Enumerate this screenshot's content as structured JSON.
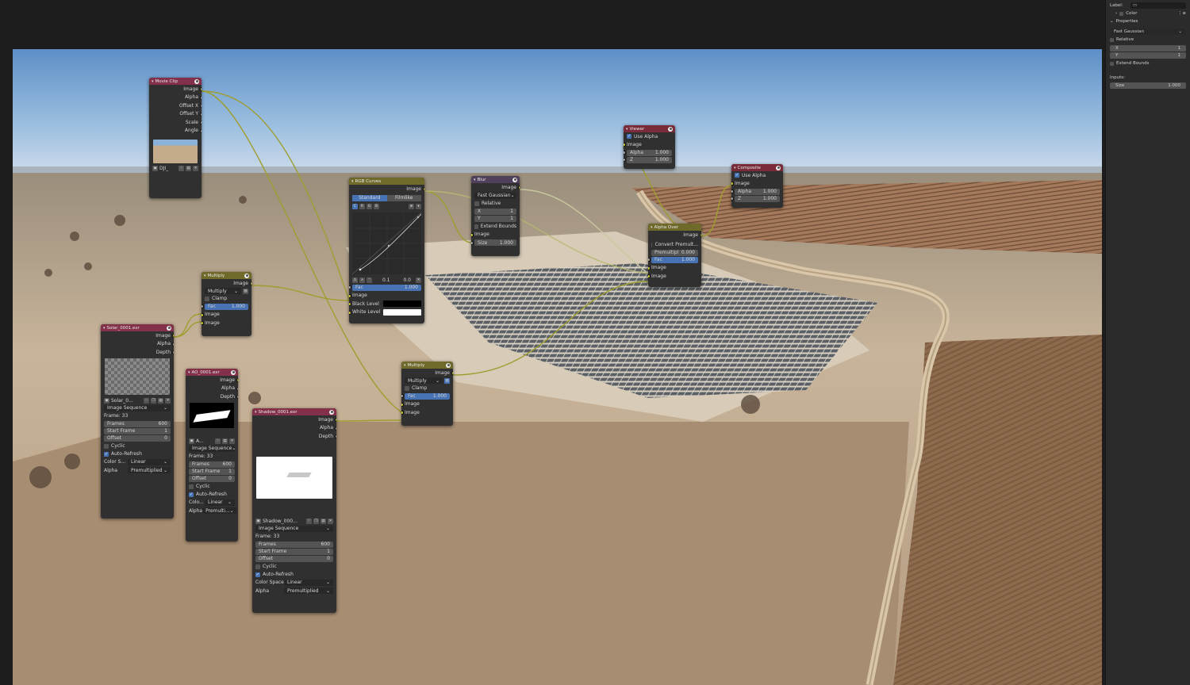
{
  "sidebar": {
    "label_caption": "Label:",
    "color_caption": "Color",
    "properties_caption": "Properties",
    "filter_type": "Fast Gaussian",
    "relative_label": "Relative",
    "x_label": "X",
    "x_value": "1",
    "y_label": "Y",
    "y_value": "1",
    "extend_bounds_label": "Extend Bounds",
    "inputs_caption": "Inputs:",
    "size_label": "Size",
    "size_value": "1.000"
  },
  "nodes": {
    "movie_clip": {
      "title": "Movie Clip",
      "outputs": [
        "Image",
        "Alpha",
        "Offset X",
        "Offset Y",
        "Scale",
        "Angle"
      ],
      "clip_name": "DJI_"
    },
    "rgb_curves": {
      "title": "RGB Curves",
      "output": "Image",
      "tab_standard": "Standard",
      "tab_filmlike": "Filmlike",
      "channels": [
        "C",
        "R",
        "G",
        "B"
      ],
      "point_x": "0.1",
      "point_y": "0.0",
      "fac_label": "Fac",
      "fac_value": "1.000",
      "inputs": [
        "Image",
        "Black Level",
        "White Level"
      ]
    },
    "blur": {
      "title": "Blur",
      "output": "Image",
      "filter_type": "Fast Gaussian",
      "relative_label": "Relative",
      "x_label": "X",
      "x_value": "1",
      "y_label": "Y",
      "y_value": "1",
      "extend_bounds_label": "Extend Bounds",
      "input": "Image",
      "size_label": "Size",
      "size_value": "1.000"
    },
    "viewer": {
      "title": "Viewer",
      "use_alpha_label": "Use Alpha",
      "inputs": [
        "Image"
      ],
      "alpha_label": "Alpha",
      "alpha_value": "1.000",
      "z_label": "Z",
      "z_value": "1.000"
    },
    "composite": {
      "title": "Composite",
      "use_alpha_label": "Use Alpha",
      "image_label": "Image",
      "alpha_label": "Alpha",
      "alpha_value": "1.000",
      "z_label": "Z",
      "z_value": "1.000"
    },
    "alpha_over": {
      "title": "Alpha Over",
      "output": "Image",
      "convert_label": "Convert Premult...",
      "premult_label": "Premultipl",
      "premult_value": "0.000",
      "fac_label": "Fac",
      "fac_value": "1.000",
      "inputs": [
        "Image",
        "Image"
      ]
    },
    "multiply_top": {
      "title": "Multiply",
      "output": "Image",
      "blend_mode": "Multiply",
      "clamp_label": "Clamp",
      "fac_label": "Fac",
      "fac_value": "1.000",
      "inputs": [
        "Image",
        "Image"
      ]
    },
    "multiply_bottom": {
      "title": "Multiply",
      "output": "Image",
      "blend_mode": "Multiply",
      "clamp_label": "Clamp",
      "fac_label": "Fac",
      "fac_value": "1.000",
      "inputs": [
        "Image",
        "Image"
      ]
    },
    "solar": {
      "title": "Solar_0001.exr",
      "outputs": [
        "Image",
        "Alpha",
        "Depth"
      ],
      "file_name": "Solar_0...",
      "source": "Image Sequence",
      "frame": "Frame: 33",
      "frames_label": "Frames",
      "frames_value": "600",
      "start_label": "Start Frame",
      "start_value": "1",
      "offset_label": "Offset",
      "offset_value": "0",
      "cyclic_label": "Cyclic",
      "auto_refresh_label": "Auto-Refresh",
      "colorspace_label": "Color S...",
      "colorspace_value": "Linear",
      "alpha_label": "Alpha",
      "alpha_value": "Premultiplied"
    },
    "ao": {
      "title": "AO_0001.exr",
      "outputs": [
        "Image",
        "Alpha",
        "Depth"
      ],
      "file_name": "A...",
      "source": "Image Sequence",
      "frame": "Frame: 33",
      "frames_label": "Frames",
      "frames_value": "600",
      "start_label": "Start Frame",
      "start_value": "1",
      "offset_label": "Offset",
      "offset_value": "0",
      "cyclic_label": "Cyclic",
      "auto_refresh_label": "Auto-Refresh",
      "colorspace_label": "Colo...",
      "colorspace_value": "Linear",
      "alpha_label": "Alpha",
      "alpha_value": "Premulti..."
    },
    "shadow": {
      "title": "Shadow_0001.exr",
      "outputs": [
        "Image",
        "Alpha",
        "Depth"
      ],
      "file_name": "Shadow_000...",
      "source": "Image Sequence",
      "frame": "Frame: 33",
      "frames_label": "Frames",
      "frames_value": "600",
      "start_label": "Start Frame",
      "start_value": "1",
      "offset_label": "Offset",
      "offset_value": "0",
      "cyclic_label": "Cyclic",
      "auto_refresh_label": "Auto-Refresh",
      "colorspace_label": "Color Space",
      "colorspace_value": "Linear",
      "alpha_label": "Alpha",
      "alpha_value": "Premultiplied"
    }
  }
}
